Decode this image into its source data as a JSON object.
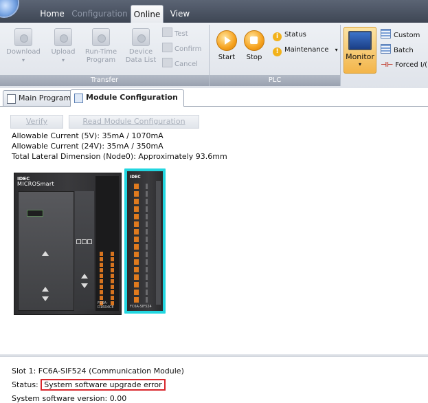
{
  "top_tabs": [
    {
      "label": "Home"
    },
    {
      "label": "Configuration"
    },
    {
      "label": "Online"
    },
    {
      "label": "View"
    }
  ],
  "ribbon": {
    "transfer": {
      "caption": "Transfer",
      "download": "Download",
      "upload": "Upload",
      "run_time_program_1": "Run-Time",
      "run_time_program_2": "Program",
      "device_data_list_1": "Device",
      "device_data_list_2": "Data List",
      "test": "Test",
      "confirm": "Confirm",
      "cancel": "Cancel"
    },
    "plc": {
      "caption": "PLC",
      "start": "Start",
      "stop": "Stop",
      "status": "Status",
      "maintenance": "Maintenance"
    },
    "monitor": {
      "monitor": "Monitor",
      "custom": "Custom",
      "batch": "Batch",
      "forced": "Forced I/("
    }
  },
  "doc_tabs": [
    {
      "label": "Main Program"
    },
    {
      "label": "Module Configuration"
    }
  ],
  "toolbar": {
    "verify": "Verify",
    "read_module_configuration": "Read Module Configuration"
  },
  "info": {
    "current_5v": "Allowable Current (5V): 35mA / 1070mA",
    "current_24v": "Allowable Current (24V): 35mA / 350mA",
    "lateral_dimension": "Total Lateral Dimension (Node0): Approximately 93.6mm"
  },
  "modules": {
    "cpu": {
      "brand": "IDEC",
      "series": "MICROSmart",
      "model": "FC6A-D16R4CE"
    },
    "comm": {
      "brand": "IDEC",
      "model": "FC6A-SIF524"
    }
  },
  "detail": {
    "slot": "Slot 1: FC6A-SIF524 (Communication Module)",
    "status_label": "Status:",
    "status_value": "System software upgrade error",
    "version": "System software version: 0.00"
  }
}
